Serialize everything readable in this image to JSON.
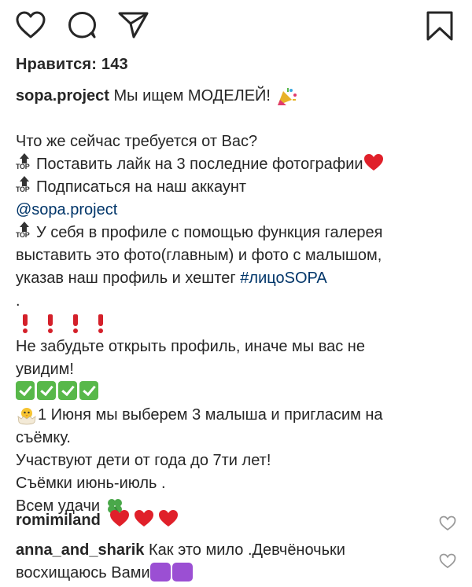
{
  "post": {
    "likes_text": "Нравится: 143"
  },
  "caption": {
    "username": "sopa.project",
    "title": "Мы ищем МОДЕЛЕЙ!",
    "question": "Что же сейчас требуется от Вас?",
    "item1": "Поставить лайк на 3 последние фотографии",
    "item2": "Подписаться на наш аккаунт",
    "account_link": "@sopa.project",
    "item3_line1": "У себя в профиле с помощью функция галерея",
    "item3_line2": "выставить это фото(главным) и фото с малышом,",
    "item3_line3": "указав наш профиль и хештег",
    "hashtag": "#лицоSOPA",
    "dot": ".",
    "reminder_line1": "Не забудьте открыть профиль, иначе мы вас не",
    "reminder_line2": "увидим!",
    "date_line1": "1 Июня мы выберем 3 малыша и пригласим на",
    "date_line2": "съёмку.",
    "age_line": "Участвуют дети от года до 7ти лет!",
    "period_line": "Съёмки июнь-июль .",
    "luck_line": "Всем удачи",
    "top_badge": "TOP"
  },
  "comments": [
    {
      "username": "romimiland",
      "text": ""
    },
    {
      "username": "anna_and_sharik",
      "text_line1": "Как это мило .Девчёночьки",
      "text_line2": "восхищаюсь Вами"
    }
  ],
  "icons": {
    "like": "heart-outline-icon",
    "comment": "comment-bubble-icon",
    "share": "paper-plane-icon",
    "save": "bookmark-icon"
  },
  "colors": {
    "text": "#262626",
    "link": "#003569",
    "heart": "#e0202a",
    "check": "#58b84a"
  }
}
